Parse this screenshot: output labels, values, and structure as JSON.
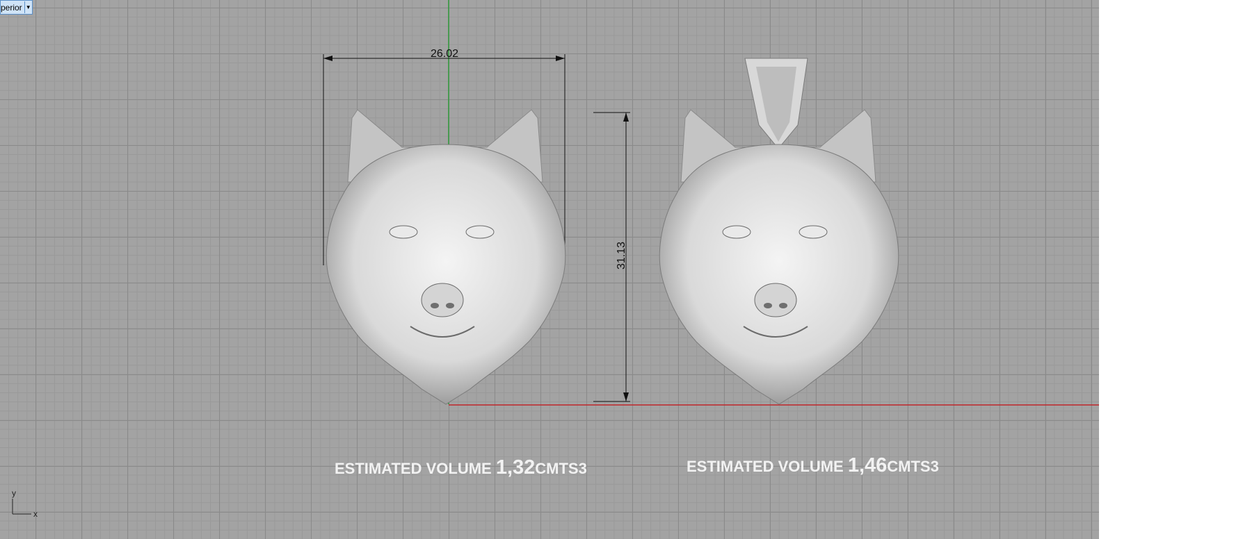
{
  "viewport": {
    "tab_label": "perior",
    "tab_menu_icon": "triangle-down-icon",
    "dimensions": {
      "width": "26.02",
      "height": "31.13"
    },
    "volumes": [
      {
        "prefix": "ESTIMATED VOLUME ",
        "value": "1,32",
        "unit": "CMTS3"
      },
      {
        "prefix": "ESTIMATED VOLUME ",
        "value": "1,46",
        "unit": "CMTS3"
      }
    ],
    "axes": {
      "y": "y",
      "x": "x"
    },
    "colors": {
      "background": "#a3a3a3",
      "x_axis": "#c0262a",
      "y_axis": "#2f9a3a"
    }
  }
}
